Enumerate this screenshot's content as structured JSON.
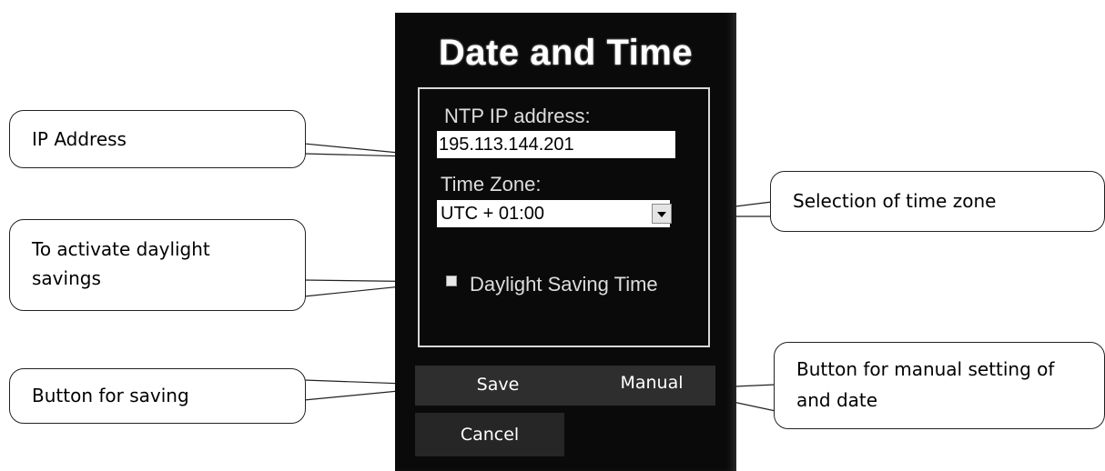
{
  "dialog": {
    "title": "Date and Time",
    "ntp_label": "NTP IP address:",
    "ntp_value": "195.113.144.201",
    "timezone_label": "Time Zone:",
    "timezone_value": "UTC + 01:00",
    "dst_label": "Daylight Saving Time",
    "dst_checked": false,
    "save_label": "Save",
    "manual_label": "Manual",
    "cancel_label": "Cancel"
  },
  "callouts": {
    "ip_address": "IP Address",
    "daylight": "To activate daylight savings",
    "saving": "Button for saving",
    "timezone": "Selection of time zone",
    "manual": "Button for manual setting of and date"
  }
}
